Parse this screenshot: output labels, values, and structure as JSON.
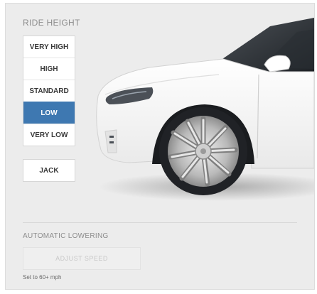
{
  "ride_height": {
    "title": "RIDE HEIGHT",
    "options": [
      {
        "label": "VERY HIGH",
        "selected": false
      },
      {
        "label": "HIGH",
        "selected": false
      },
      {
        "label": "STANDARD",
        "selected": false
      },
      {
        "label": "LOW",
        "selected": true
      },
      {
        "label": "VERY LOW",
        "selected": false
      }
    ],
    "jack_label": "JACK"
  },
  "automatic_lowering": {
    "title": "AUTOMATIC LOWERING",
    "adjust_speed_label": "ADJUST SPEED",
    "note": "Set to 60+ mph"
  },
  "colors": {
    "panel_background": "#ececec",
    "selected": "#3e78b1",
    "car_body": "#ffffff"
  },
  "icons": {
    "vehicle": "car-front-quarter-illustration"
  }
}
